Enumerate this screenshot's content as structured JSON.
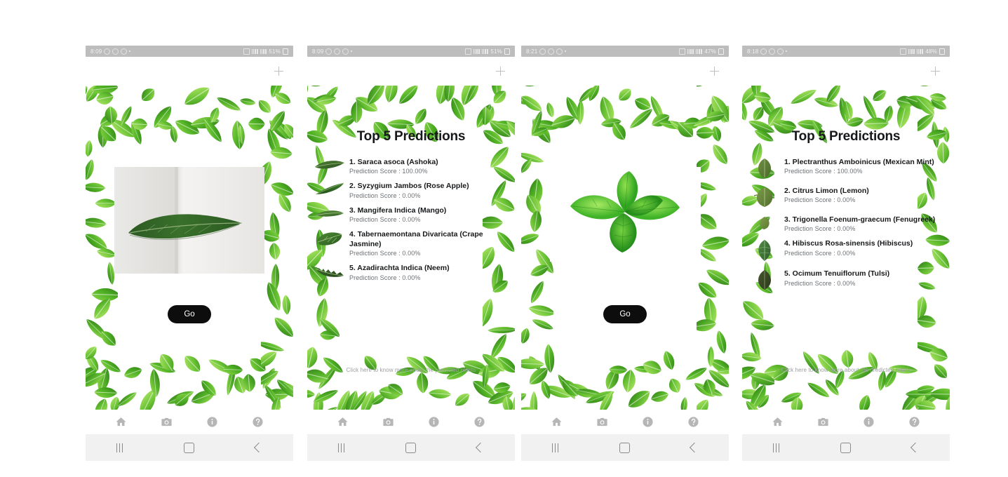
{
  "app": {
    "title_predictions": "Top 5 Predictions",
    "go_label": "Go",
    "more_link": "Click here to know more about the predicted plants",
    "score_prefix": "Prediction Score : ",
    "accent_button_color": "#0d0d0d",
    "leaf_border_color": "#4caf27",
    "statusbar_color": "#bdbdbd",
    "sysnav_color": "#f1f1f1"
  },
  "bottom_nav": [
    {
      "name": "home-icon",
      "label": "Home"
    },
    {
      "name": "camera-icon",
      "label": "Camera"
    },
    {
      "name": "info-icon",
      "label": "Info"
    },
    {
      "name": "help-icon",
      "label": "Help"
    }
  ],
  "system_nav": [
    {
      "name": "recents-button",
      "label": "|||"
    },
    {
      "name": "home-button",
      "label": "O"
    },
    {
      "name": "back-button",
      "label": "<"
    }
  ],
  "panels": [
    {
      "id": "panel-1-capture",
      "status": {
        "time": "8:09",
        "battery": "51%"
      },
      "screen_type": "capture",
      "photo_alt": "long narrow dark green leaf on white background",
      "predictions": []
    },
    {
      "id": "panel-2-results",
      "status": {
        "time": "8:09",
        "battery": "51%"
      },
      "screen_type": "results",
      "title": "Top 5 Predictions",
      "predictions": [
        {
          "rank": "1.",
          "name": "1. Saraca asoca (Ashoka)",
          "score": "Prediction Score : 100.00%",
          "score_value": 100.0,
          "leaf": "lance-long"
        },
        {
          "rank": "2.",
          "name": "2. Syzygium Jambos (Rose Apple)",
          "score": "Prediction Score : 0.00%",
          "score_value": 0.0,
          "leaf": "lance-slim"
        },
        {
          "rank": "3.",
          "name": "3. Mangifera Indica (Mango)",
          "score": "Prediction Score : 0.00%",
          "score_value": 0.0,
          "leaf": "oblong-flat"
        },
        {
          "rank": "4.",
          "name": "4. Tabernaemontana Divaricata (Crape Jasmine)",
          "score": "Prediction Score : 0.00%",
          "score_value": 0.0,
          "leaf": "ovate-wide"
        },
        {
          "rank": "5.",
          "name": "5. Azadirachta Indica (Neem)",
          "score": "Prediction Score : 0.00%",
          "score_value": 0.0,
          "leaf": "serrated-curve"
        }
      ],
      "more_link": "Click here to know more about the predicted plants"
    },
    {
      "id": "panel-3-capture",
      "status": {
        "time": "8:21",
        "battery": "47%"
      },
      "screen_type": "capture",
      "photo_alt": "bright green mint sprig on white background",
      "predictions": []
    },
    {
      "id": "panel-4-results",
      "status": {
        "time": "8:18",
        "battery": "48%"
      },
      "screen_type": "results",
      "title": "Top 5 Predictions",
      "predictions": [
        {
          "rank": "1.",
          "name": "1. Plectranthus Amboinicus (Mexican Mint)",
          "score": "Prediction Score : 100.00%",
          "score_value": 100.0,
          "leaf": "round-olive"
        },
        {
          "rank": "2.",
          "name": "2. Citrus Limon (Lemon)",
          "score": "Prediction Score : 0.00%",
          "score_value": 0.0,
          "leaf": "round-wide"
        },
        {
          "rank": "3.",
          "name": "3. Trigonella Foenum-graecum (Fenugreek)",
          "score": "Prediction Score : 0.00%",
          "score_value": 0.0,
          "leaf": "small-round"
        },
        {
          "rank": "4.",
          "name": "4. Hibiscus Rosa-sinensis (Hibiscus)",
          "score": "Prediction Score : 0.00%",
          "score_value": 0.0,
          "leaf": "pointed-green"
        },
        {
          "rank": "5.",
          "name": "5. Ocimum Tenuiflorum (Tulsi)",
          "score": "Prediction Score : 0.00%",
          "score_value": 0.0,
          "leaf": "dark-oval"
        }
      ],
      "more_link": "Click here to know more about the predicted plants"
    }
  ]
}
